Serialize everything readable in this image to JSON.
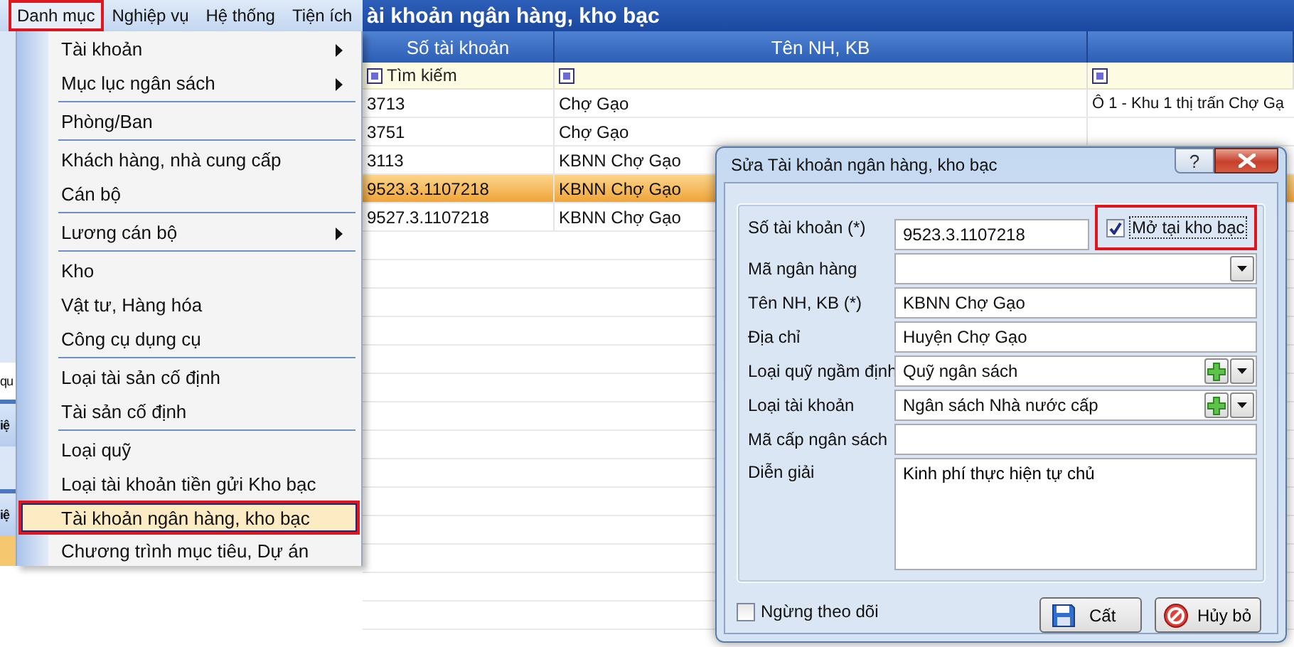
{
  "menu_bar": {
    "items": [
      {
        "label": "Danh mục",
        "selected": true,
        "highlighted": true
      },
      {
        "label": "Nghiệp vụ",
        "selected": false,
        "highlighted": false
      },
      {
        "label": "Hệ thống",
        "selected": false,
        "highlighted": false
      },
      {
        "label": "Tiện ích",
        "selected": false,
        "highlighted": false
      }
    ]
  },
  "side_panel": {
    "fragments": [
      {
        "text": "qu",
        "kind": "plain"
      },
      {
        "text": "iệ",
        "kind": "header"
      },
      {
        "text": "iệ",
        "kind": "header"
      }
    ]
  },
  "dropdown_menu": {
    "items": [
      {
        "kind": "item",
        "label": "Tài khoản",
        "submenu": true,
        "selected": false,
        "highlighted": false
      },
      {
        "kind": "item",
        "label": "Mục lục ngân sách",
        "submenu": true,
        "selected": false,
        "highlighted": false
      },
      {
        "kind": "separator"
      },
      {
        "kind": "item",
        "label": "Phòng/Ban",
        "submenu": false,
        "selected": false,
        "highlighted": false
      },
      {
        "kind": "separator"
      },
      {
        "kind": "item",
        "label": "Khách hàng, nhà cung cấp",
        "submenu": false,
        "selected": false,
        "highlighted": false
      },
      {
        "kind": "item",
        "label": "Cán bộ",
        "submenu": false,
        "selected": false,
        "highlighted": false
      },
      {
        "kind": "separator"
      },
      {
        "kind": "item",
        "label": "Lương cán bộ",
        "submenu": true,
        "selected": false,
        "highlighted": false
      },
      {
        "kind": "separator"
      },
      {
        "kind": "item",
        "label": "Kho",
        "submenu": false,
        "selected": false,
        "highlighted": false
      },
      {
        "kind": "item",
        "label": "Vật tư, Hàng hóa",
        "submenu": false,
        "selected": false,
        "highlighted": false
      },
      {
        "kind": "item",
        "label": "Công cụ dụng cụ",
        "submenu": false,
        "selected": false,
        "highlighted": false
      },
      {
        "kind": "separator"
      },
      {
        "kind": "item",
        "label": "Loại tài sản cố định",
        "submenu": false,
        "selected": false,
        "highlighted": false
      },
      {
        "kind": "item",
        "label": "Tài sản cố định",
        "submenu": false,
        "selected": false,
        "highlighted": false
      },
      {
        "kind": "separator"
      },
      {
        "kind": "item",
        "label": "Loại quỹ",
        "submenu": false,
        "selected": false,
        "highlighted": false
      },
      {
        "kind": "item",
        "label": "Loại tài khoản tiền gửi Kho bạc",
        "submenu": false,
        "selected": false,
        "highlighted": false
      },
      {
        "kind": "item",
        "label": "Tài khoản ngân hàng, kho bạc",
        "submenu": false,
        "selected": true,
        "highlighted": true
      },
      {
        "kind": "item",
        "label": "Chương trình mục tiêu, Dự án",
        "submenu": false,
        "selected": false,
        "highlighted": false
      }
    ]
  },
  "list": {
    "title": "ài khoản ngân hàng, kho bạc",
    "columns": [
      "Số tài khoản",
      "Tên NH, KB"
    ],
    "filter_placeholder": "Tìm kiếm",
    "rows": [
      {
        "account": "3713",
        "bank": "Chợ Gạo",
        "address": "Ô 1 - Khu 1 thị trấn Chợ Gạ",
        "selected": false
      },
      {
        "account": "3751",
        "bank": "Chợ Gạo",
        "selected": false
      },
      {
        "account": "3113",
        "bank": "KBNN Chợ Gạo",
        "selected": false
      },
      {
        "account": "9523.3.1107218",
        "bank": "KBNN Chợ Gạo",
        "selected": true
      },
      {
        "account": "9527.3.1107218",
        "bank": "KBNN Chợ Gạo",
        "selected": false
      }
    ]
  },
  "dialog": {
    "title": "Sửa Tài khoản ngân hàng, kho bạc",
    "help_button": "?",
    "fields": [
      {
        "kind": "text",
        "label": "Số tài khoản (*)",
        "value": "9523.3.1107218"
      },
      {
        "kind": "combo",
        "label": "Mã ngân hàng"
      },
      {
        "kind": "text",
        "label": "Tên NH, KB (*)",
        "value": "KBNN Chợ Gạo"
      },
      {
        "kind": "text",
        "label": "Địa chỉ",
        "value": "Huyện Chợ Gạo"
      },
      {
        "kind": "combo_add",
        "label": "Loại quỹ ngầm định",
        "value": "Quỹ ngân sách"
      },
      {
        "kind": "combo_add",
        "label": "Loại tài khoản",
        "value": "Ngân sách Nhà nước cấp"
      },
      {
        "kind": "text",
        "label": "Mã cấp ngân sách"
      },
      {
        "kind": "textarea",
        "label": "Diễn giải",
        "value": "Kinh phí thực hiện tự chủ"
      }
    ],
    "treasury_checkbox": {
      "label": "Mở tại kho bạc",
      "checked": true,
      "highlighted": true
    },
    "stop_tracking": {
      "label": "Ngừng theo dõi",
      "checked": false
    },
    "buttons": [
      {
        "kind": "save",
        "label": "Cất"
      },
      {
        "kind": "cancel",
        "label": "Hủy bỏ"
      }
    ]
  }
}
